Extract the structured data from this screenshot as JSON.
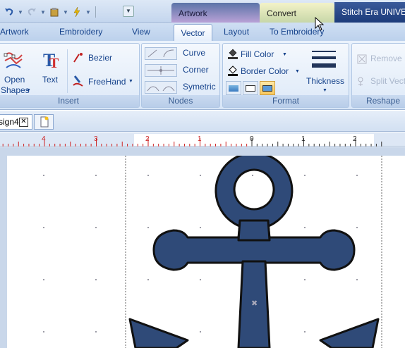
{
  "titlebar": {
    "context_tabs": [
      {
        "label": "Artwork"
      },
      {
        "label": "Convert"
      }
    ],
    "app_title": "Stitch Era UNIVERSAL"
  },
  "ribbon_tabs": [
    "Artwork",
    "Embroidery",
    "View",
    "Vector",
    "Layout",
    "To Embroidery"
  ],
  "active_tab": "Vector",
  "groups": {
    "insert": {
      "label": "Insert",
      "open_shapes": [
        "Open",
        "Shapes"
      ],
      "text": "Text",
      "bezier": "Bezier",
      "freehand": "FreeHand"
    },
    "nodes": {
      "label": "Nodes",
      "curve": "Curve",
      "corner": "Corner",
      "symmetric": "Symetric"
    },
    "format": {
      "label": "Format",
      "fill_color": "Fill Color",
      "border_color": "Border Color",
      "thickness": "Thickness"
    },
    "reshape": {
      "label": "Reshape",
      "remove": "Remove H",
      "split": "Split Vect"
    }
  },
  "document": {
    "tab_label": "sign4"
  },
  "ruler": {
    "labels": [
      "4",
      "3",
      "2",
      "1",
      "0",
      "1",
      "2"
    ]
  },
  "colors": {
    "anchor_fill": "#2f4a78",
    "anchor_stroke": "#111111",
    "ribbon_text": "#15428b",
    "ruler_red": "#cc2222"
  }
}
